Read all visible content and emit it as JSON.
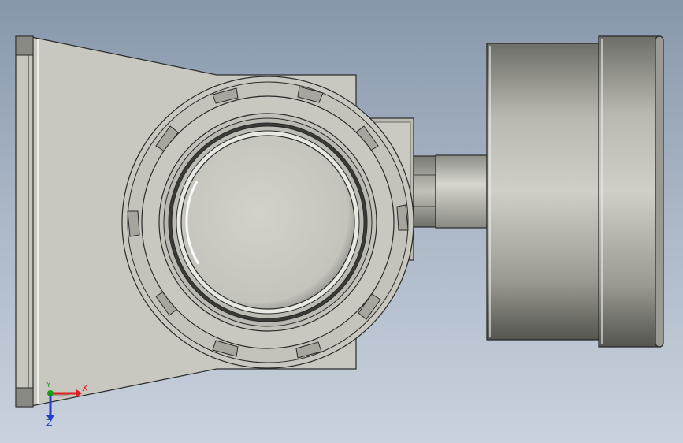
{
  "viewport": {
    "background_top": "#8797ab",
    "background_bottom": "#c9d2de",
    "model_color": "#c8c8c0",
    "edge_color": "#2a2a2a"
  },
  "triad": {
    "x_label": "X",
    "y_label": "Y",
    "z_label": "Z",
    "x_color": "#e02020",
    "y_color": "#1a9a1a",
    "z_color": "#1f3fc8"
  }
}
